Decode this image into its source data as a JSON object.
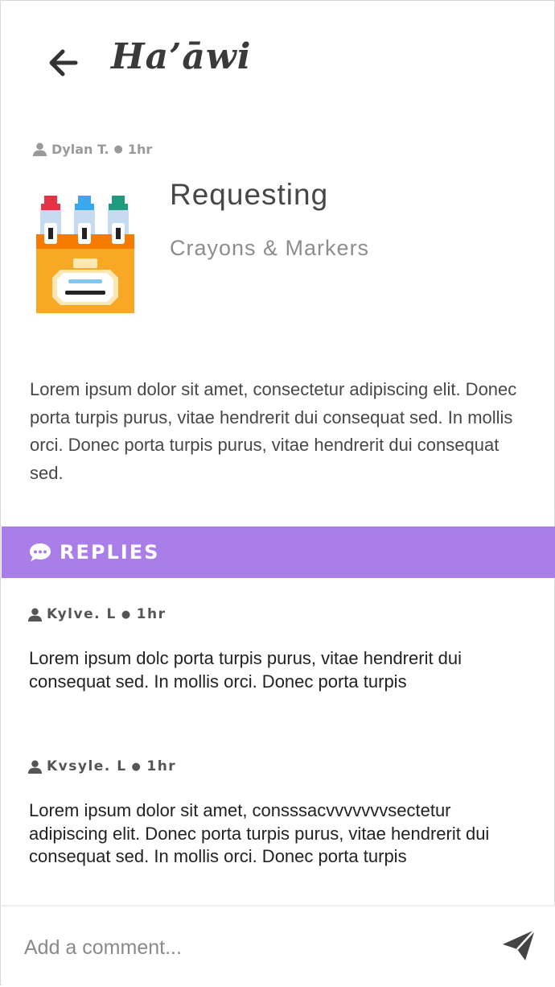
{
  "header": {
    "title": "Ha’āwi",
    "back_icon": "arrow-left-icon"
  },
  "post": {
    "author": "Dylan T.",
    "separator": "●",
    "time": "1hr",
    "type": "Requesting",
    "category": "Crayons & Markers",
    "icon": "crayon-box-icon",
    "body": "Lorem ipsum dolor sit amet, consectetur adipiscing elit. Donec porta turpis purus, vitae hendrerit dui consequat sed. In mollis orci. Donec porta turpis purus, vitae hendrerit dui consequat sed."
  },
  "replies": {
    "title": "REPLIES",
    "icon": "chat-bubble-icon",
    "accent_color": "#a97ee9",
    "items": [
      {
        "author": "Kylve. L",
        "separator": "●",
        "time": "1hr",
        "body": "Lorem ipsum dolc porta turpis purus, vitae hendrerit dui consequat sed. In mollis orci. Donec porta turpis"
      },
      {
        "author": "Kvsyle. L",
        "separator": "●",
        "time": "1hr",
        "body": "Lorem ipsum dolor sit amet, consssacvvvvvvvsectetur adipiscing elit. Donec porta turpis purus, vitae hendrerit dui consequat sed. In mollis orci. Donec porta turpis"
      }
    ]
  },
  "comment": {
    "placeholder": "Add a comment...",
    "value": "",
    "send_icon": "send-icon"
  }
}
